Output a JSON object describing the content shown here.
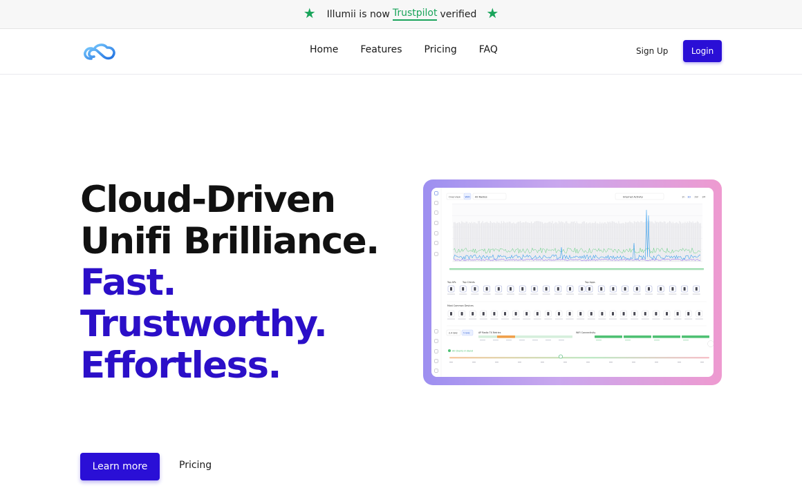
{
  "topbar": {
    "prefix": "Illumii is now",
    "link": "Trustpilot",
    "suffix": "verified"
  },
  "nav": {
    "links": [
      "Home",
      "Features",
      "Pricing",
      "FAQ"
    ],
    "signup": "Sign Up",
    "login": "Login"
  },
  "hero": {
    "line1": "Cloud-Driven",
    "line2": "Unifi Brilliance.",
    "line3": "Fast.",
    "line4": "Trustworthy.",
    "line5": "Effortless."
  },
  "cta": {
    "primary": "Learn more",
    "secondary": "Pricing"
  },
  "mockup": {
    "tab_overview": "Overview",
    "tab_wifi": "WiFi",
    "filter": "All Radios",
    "chart_title": "Internet Activity",
    "range_buttons": [
      "1h",
      "1D",
      "1W",
      "1M"
    ],
    "section_top_aps": "Top APs",
    "section_top_clients": "Top Clients",
    "section_top_apps": "Top Apps",
    "section_most_common": "Most Common Devices",
    "section_radio_tx": "AP Radio TX Retries",
    "section_wifi_connectivity": "WiFi Connectivity",
    "section_signal": "All Clients in Band",
    "toggle_a": "2.4 GHz",
    "toggle_b": "5 GHz"
  },
  "colors": {
    "brand": "#2a0fd6",
    "accent_text": "#2b0fc8",
    "trustpilot": "#19a45a"
  },
  "icons": {
    "star": "star-icon",
    "logo": "cloud-logo-icon"
  }
}
